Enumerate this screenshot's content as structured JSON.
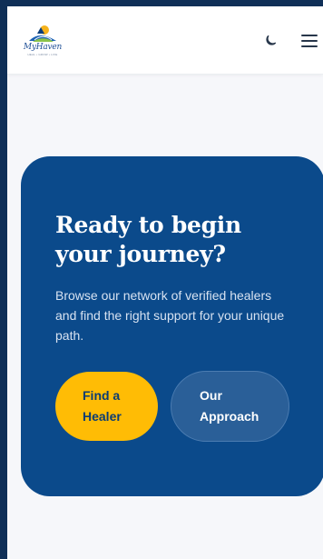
{
  "header": {
    "logo_name": "MyHaven",
    "logo_tagline": "HEAL • GROW • LIVE",
    "icons": {
      "theme": "moon-icon",
      "menu": "hamburger-menu-icon"
    }
  },
  "cta": {
    "title": "Ready to begin your journey?",
    "description": "Browse our network of verified healers and find the right support for your unique path.",
    "primary_button": "Find a Healer",
    "secondary_button": "Our Approach"
  },
  "colors": {
    "page_background": "#0f2f57",
    "card_background": "#0b4a8b",
    "primary_button": "#ffbc05",
    "secondary_button": "#2a5f98"
  }
}
